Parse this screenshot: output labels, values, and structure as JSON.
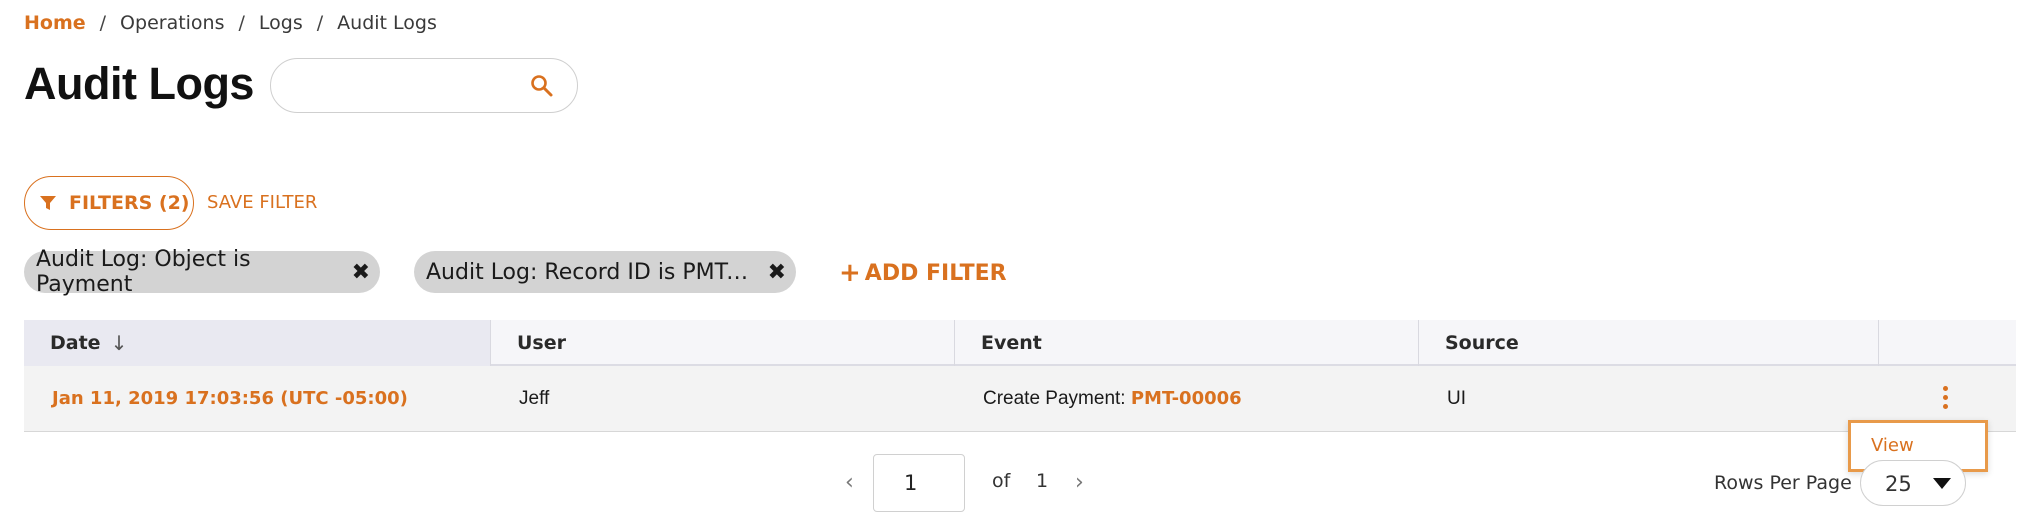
{
  "breadcrumb": {
    "home": "Home",
    "sep": "/",
    "items": [
      "Operations",
      "Logs",
      "Audit Logs"
    ]
  },
  "page": {
    "title": "Audit Logs"
  },
  "search": {
    "value": "",
    "placeholder": "",
    "icon": "search-icon"
  },
  "filters": {
    "button_label": "FILTERS (2)",
    "save_label": "SAVE FILTER",
    "add_label": "ADD FILTER",
    "add_icon": "+",
    "chips": [
      {
        "label": "Audit Log: Object is Payment"
      },
      {
        "label": "Audit Log: Record ID is PMT-0..."
      }
    ],
    "chip_remove": "✖"
  },
  "table": {
    "columns": [
      {
        "label": "Date",
        "sort": "↓"
      },
      {
        "label": "User"
      },
      {
        "label": "Event"
      },
      {
        "label": "Source"
      }
    ],
    "rows": [
      {
        "date": "Jan 11, 2019 17:03:56 (UTC -05:00)",
        "user": "Jeff",
        "event_prefix": "Create Payment: ",
        "event_link": "PMT-00006",
        "source": "UI"
      }
    ]
  },
  "row_menu": {
    "items": [
      "View"
    ]
  },
  "pagination": {
    "prev": "‹",
    "current": "1",
    "of_label": "of",
    "total": "1",
    "next": "›",
    "rows_per_page_label": "Rows Per Page",
    "rows_per_page": "25"
  },
  "colors": {
    "accent": "#d9711f",
    "chip_bg": "#d3d3d3",
    "header_bg": "#f6f6f9",
    "row_bg": "#f3f3f3"
  }
}
